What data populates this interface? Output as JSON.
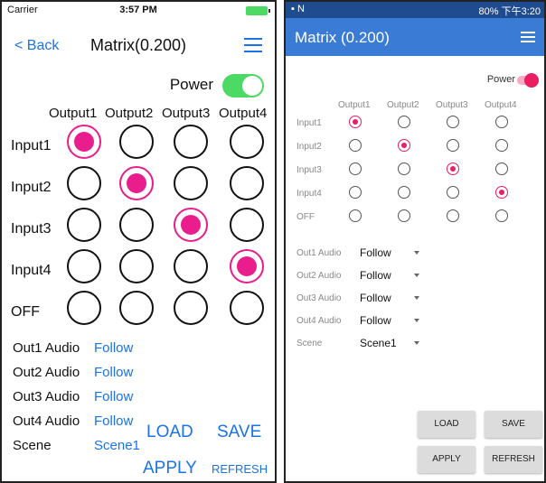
{
  "ios": {
    "status": {
      "carrier": "Carrier",
      "time": "3:57 PM"
    },
    "nav": {
      "back": "< Back",
      "title": "Matrix(0.200)"
    },
    "power": {
      "label": "Power",
      "on": true
    },
    "outputs": [
      "Output1",
      "Output2",
      "Output3",
      "Output4"
    ],
    "rows": [
      {
        "label": "Input1",
        "selected": 0
      },
      {
        "label": "Input2",
        "selected": 1
      },
      {
        "label": "Input3",
        "selected": 2
      },
      {
        "label": "Input4",
        "selected": 3
      },
      {
        "label": "OFF",
        "selected": -1
      }
    ],
    "audio": [
      {
        "key": "Out1 Audio",
        "value": "Follow"
      },
      {
        "key": "Out2 Audio",
        "value": "Follow"
      },
      {
        "key": "Out3 Audio",
        "value": "Follow"
      },
      {
        "key": "Out4 Audio",
        "value": "Follow"
      }
    ],
    "scene": {
      "key": "Scene",
      "value": "Scene1"
    },
    "buttons": {
      "load": "LOAD",
      "save": "SAVE",
      "apply": "APPLY",
      "refresh": "REFRESH"
    }
  },
  "android": {
    "status": {
      "right": "80% 下午3:20"
    },
    "title": "Matrix (0.200)",
    "power": {
      "label": "Power",
      "on": true
    },
    "outputs": [
      "Output1",
      "Output2",
      "Output3",
      "Output4"
    ],
    "rows": [
      {
        "label": "Input1",
        "selected": 0
      },
      {
        "label": "Input2",
        "selected": 1
      },
      {
        "label": "Input3",
        "selected": 2
      },
      {
        "label": "Input4",
        "selected": 3
      },
      {
        "label": "OFF",
        "selected": -1
      }
    ],
    "audio": [
      {
        "key": "Out1 Audio",
        "value": "Follow"
      },
      {
        "key": "Out2 Audio",
        "value": "Follow"
      },
      {
        "key": "Out3 Audio",
        "value": "Follow"
      },
      {
        "key": "Out4 Audio",
        "value": "Follow"
      }
    ],
    "scene": {
      "key": "Scene",
      "value": "Scene1"
    },
    "buttons": {
      "load": "LOAD",
      "save": "SAVE",
      "apply": "APPLY",
      "refresh": "REFRESH"
    }
  },
  "colors": {
    "accent": "#1a73e8",
    "selected": "#e91e8c",
    "toggle_on": "#4cd964",
    "android_bar": "#3a7bd5",
    "android_status": "#1f4c8f"
  }
}
